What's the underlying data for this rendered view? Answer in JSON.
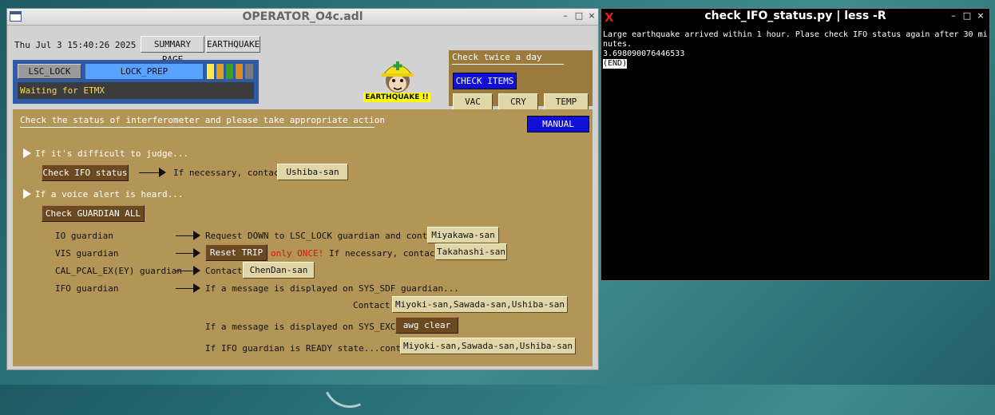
{
  "medm": {
    "title": "OPERATOR_O4c.adl",
    "controls": {
      "minimize": "–",
      "maximize": "□",
      "close": "×"
    },
    "datetime": "Thu Jul  3 15:40:26 2025",
    "summary_label": "SUMMARY PAGE",
    "earthquake_label": "EARTHQUAKE",
    "lsc_lock_label": "LSC_LOCK",
    "lock_state": "LOCK_PREP",
    "status_message": "Waiting for ETMX",
    "status_bits": [
      "#ffe94a",
      "#e0a020",
      "#3aa020",
      "#e08a20",
      "#7a7a7a"
    ],
    "eq_alert": "EARTHQUAKE !!",
    "check_panel": {
      "title": "Check twice a day",
      "check_items_label": "CHECK ITEMS",
      "buttons": [
        "VAC",
        "CRY",
        "TEMP"
      ]
    },
    "main": {
      "title": "Check the status of interferometer and please take appropriate action",
      "manual_label": "MANUAL",
      "section1": "If it's difficult to judge...",
      "check_ifo_label": "Check IFO status",
      "if_necessary_contact": "If necessary, contact",
      "ushiba_label": "Ushiba-san",
      "section2": "If a voice alert is heard...",
      "check_guardian_label": "Check GUARDIAN ALL",
      "io_guardian": "IO guardian",
      "io_action": "Request DOWN to LSC_LOCK guardian and contact",
      "miyakawa_label": "Miyakawa-san",
      "vis_guardian": "VIS guardian",
      "reset_trip_label": "Reset TRIP",
      "only_once": "only ONCE!",
      "vis_contact": "If necessary, contact",
      "takahashi_label": "Takahashi-san",
      "cal_guardian": "CAL_PCAL_EX(EY) guardian",
      "contact_word": "Contact",
      "chendan_label": "ChenDan-san",
      "ifo_guardian": "IFO guardian",
      "sdf_msg": "If a message is displayed on SYS_SDF guardian...",
      "sdf_contact": "Contact",
      "sdf_people": "Miyoki-san,Sawada-san,Ushiba-san",
      "exc_msg": "If a message is displayed on SYS_EXC...",
      "awg_clear_label": "awg clear",
      "ready_msg": "If IFO guardian is READY state...contact",
      "ready_people": "Miyoki-san,Sawada-san,Ushiba-san"
    }
  },
  "terminal": {
    "title": "check_IFO_status.py | less -R",
    "controls": {
      "minimize": "–",
      "maximize": "□",
      "close": "×"
    },
    "lines": [
      "Large earthquake arrived within 1 hour. Plase check IFO status again after 30 mi",
      "nutes.",
      "3.698090076446533"
    ],
    "end_marker": "(END)"
  }
}
